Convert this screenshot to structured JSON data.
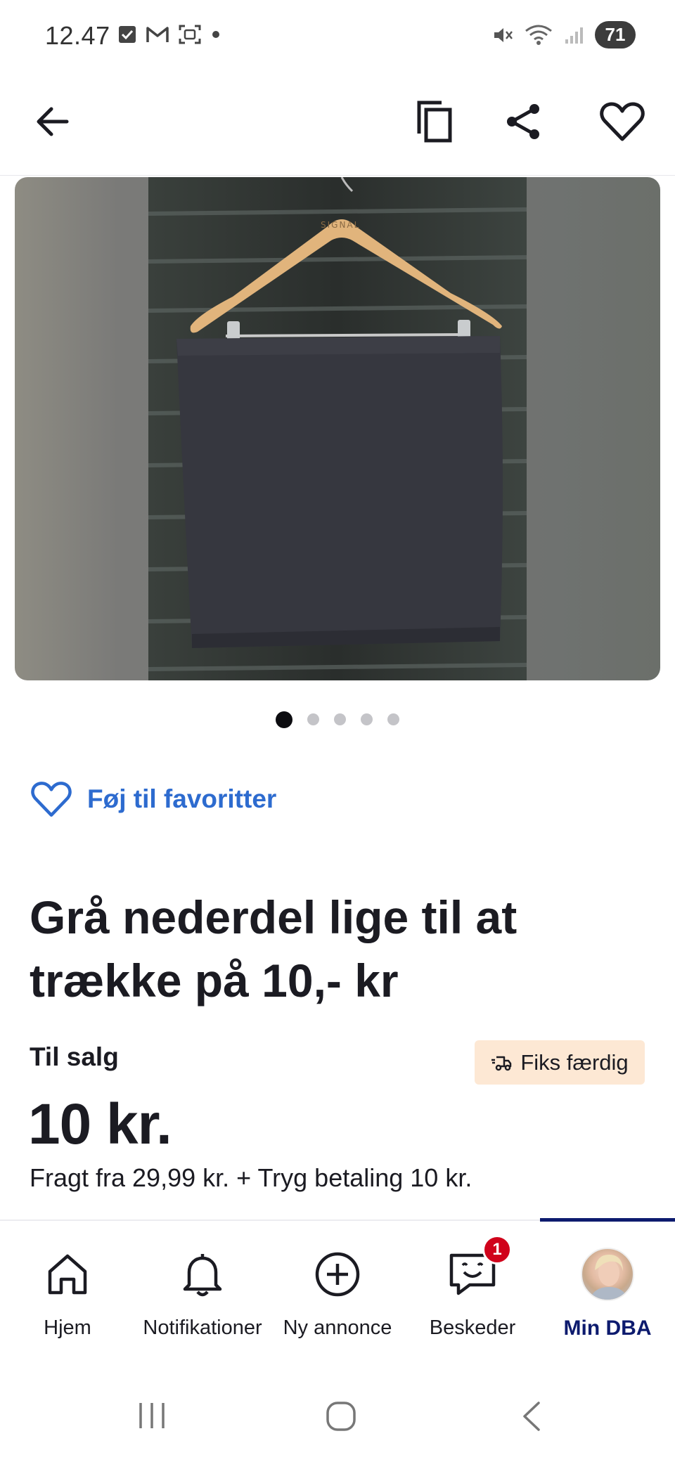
{
  "status_bar": {
    "time": "12.47",
    "battery": "71",
    "icons_left": [
      "checkbox-icon",
      "gmail-icon",
      "screenshot-icon",
      "dot-icon"
    ],
    "icons_right": [
      "mute-icon",
      "wifi-icon",
      "signal-icon"
    ]
  },
  "header": {
    "icons": [
      "back-arrow-icon",
      "copy-icon",
      "share-icon",
      "heart-outline-icon"
    ]
  },
  "gallery": {
    "image_count": 5,
    "active_index": 0,
    "hanger_text": "SIGNAL"
  },
  "favorite": {
    "label": "Føj til favoritter"
  },
  "listing": {
    "title": "Grå nederdel lige til at trække på 10,- kr",
    "status": "Til salg",
    "price": "10 kr.",
    "shipping": "Fragt fra 29,99 kr. + Tryg betaling 10 kr.",
    "badge_label": "Fiks færdig"
  },
  "bottom_nav": {
    "items": [
      {
        "label": "Hjem",
        "icon": "home-icon"
      },
      {
        "label": "Notifikationer",
        "icon": "bell-icon"
      },
      {
        "label": "Ny annonce",
        "icon": "plus-circle-icon"
      },
      {
        "label": "Beskeder",
        "icon": "chat-icon",
        "badge": "1"
      },
      {
        "label": "Min DBA",
        "icon": "avatar",
        "active": true
      }
    ]
  },
  "colors": {
    "accent_blue": "#2d6bcf",
    "active_nav": "#0d1b6e",
    "badge_red": "#d0021b",
    "fiks_badge_bg": "#fde8d4"
  }
}
